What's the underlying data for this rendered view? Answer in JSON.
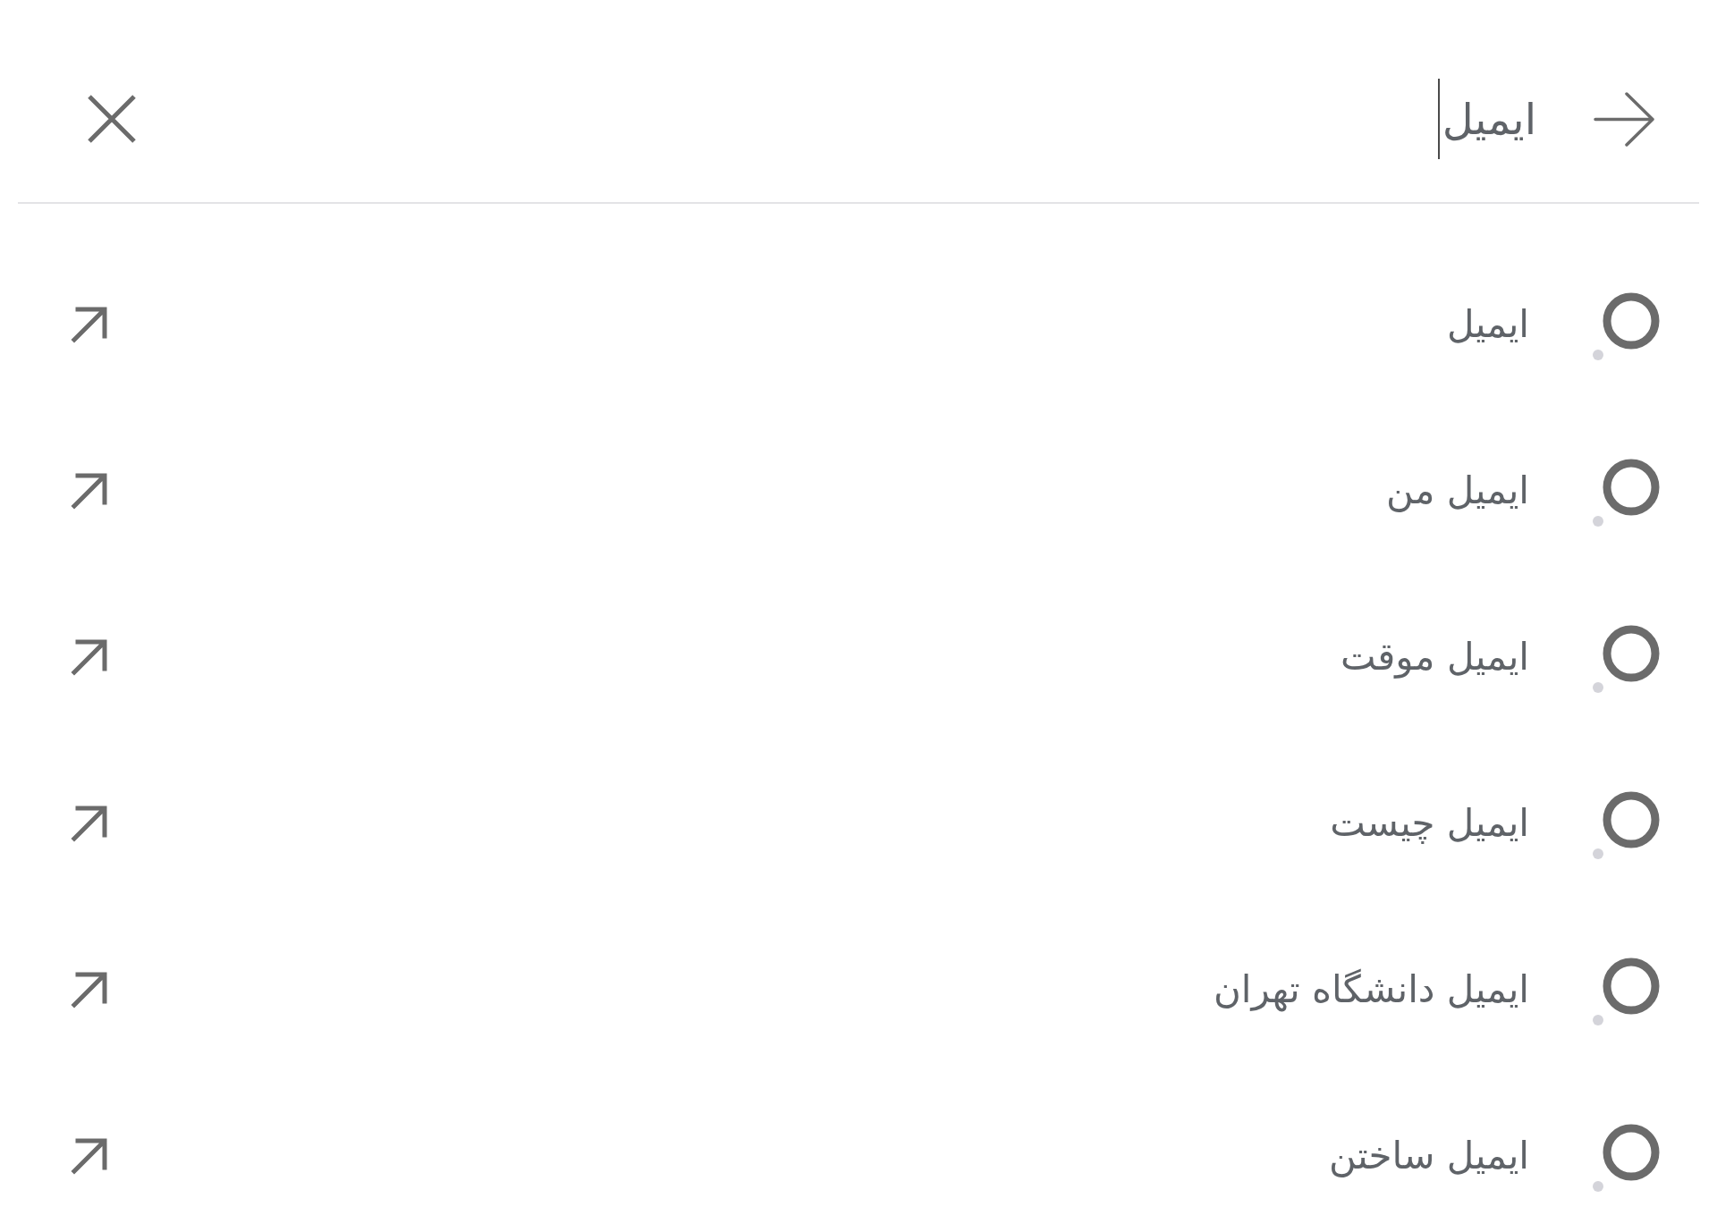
{
  "search": {
    "value": "ایمیل",
    "focused": true
  },
  "suggestions": [
    {
      "text": "ایمیل"
    },
    {
      "text": "ایمیل من"
    },
    {
      "text": "ایمیل موقت"
    },
    {
      "text": "ایمیل چیست"
    },
    {
      "text": "ایمیل دانشگاه تهران"
    },
    {
      "text": "ایمیل ساختن"
    }
  ]
}
